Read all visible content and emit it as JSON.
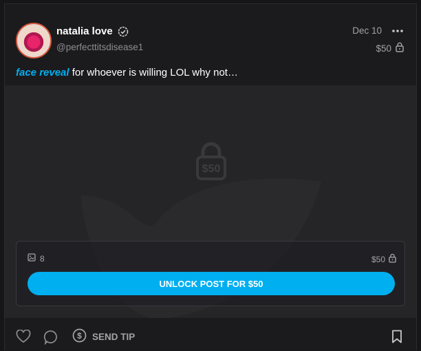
{
  "post": {
    "author_name": "natalia love",
    "handle": "@perfecttitsdisease1",
    "date": "Dec 10",
    "price": "$50",
    "caption_tag": "face reveal",
    "caption_text": " for whoever is willing LOL why not…"
  },
  "media": {
    "lock_price": "$50",
    "item_count": "8",
    "price": "$50",
    "unlock_label": "UNLOCK POST FOR $50"
  },
  "footer": {
    "tip_label": "SEND TIP"
  },
  "colors": {
    "accent": "#00aff0",
    "card_bg": "#1b1b1d",
    "media_bg": "#252528",
    "muted_text": "#a3a3a8"
  }
}
